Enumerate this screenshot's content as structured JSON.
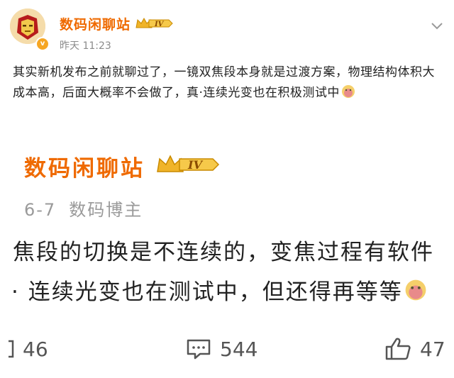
{
  "post": {
    "author": "数码闲聊站",
    "badge_level": "IV",
    "timestamp": "昨天 11:23",
    "body": "其实新机发布之前就聊过了，一镜双焦段本身就是过渡方案，物理结构体积大成本高，后面大概率不会做了，真·连续光变也在积极测试中",
    "emoji": "doge-face"
  },
  "embedded": {
    "author": "数码闲聊站",
    "badge_level": "IV",
    "date": "6-7",
    "source": "数码博主",
    "line1": "焦段的切换是不连续的，变焦过程有软件",
    "line2": "· 连续光变也在测试中，但还得再等等"
  },
  "actions": {
    "share_count": "46",
    "comment_count": "544",
    "like_count": "47"
  },
  "colors": {
    "brand_orange": "#ef6a00",
    "badge_gold": "#f6a623",
    "meta_gray": "#8b8b8b"
  }
}
